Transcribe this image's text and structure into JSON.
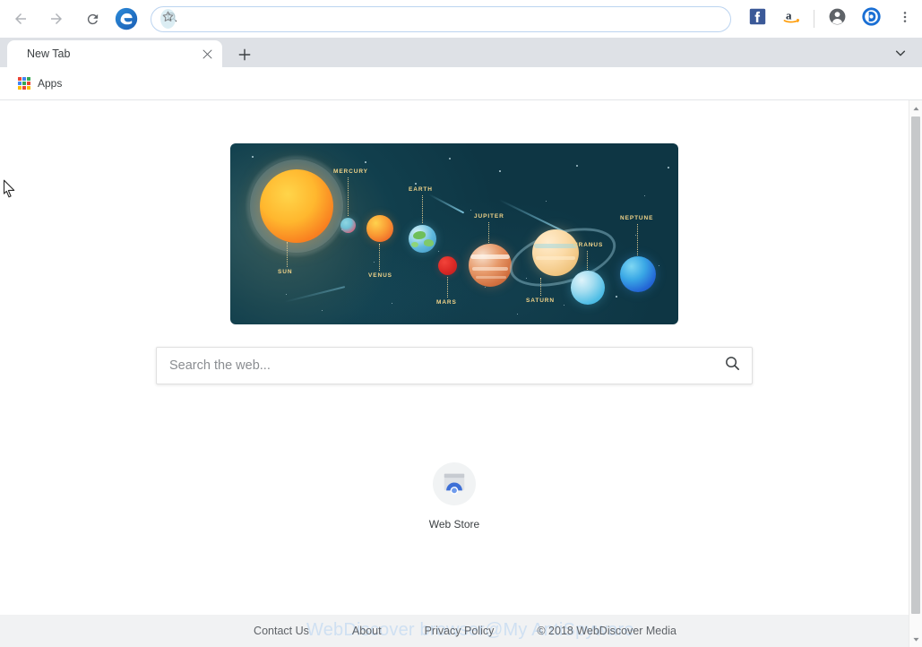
{
  "browser": {
    "toolbar": {
      "back_icon": "arrow-left-icon",
      "forward_icon": "arrow-right-icon",
      "reload_icon": "reload-icon",
      "brand_icon": "edge-logo-icon",
      "omnibox_value": "",
      "omnibox_placeholder": "",
      "omnibox_search_icon": "search-icon",
      "bookmark_star_icon": "star-icon",
      "ext_facebook_icon": "facebook-icon",
      "ext_amazon_icon": "amazon-icon",
      "profile_icon": "profile-avatar-icon",
      "webdiscover_icon": "webdiscover-icon",
      "menu_icon": "three-dot-menu-icon"
    },
    "tabstrip": {
      "tabs": [
        {
          "title": "New Tab",
          "close_icon": "close-icon"
        }
      ],
      "new_tab_icon": "plus-icon",
      "tab_list_icon": "chevron-down-icon"
    },
    "bookmarks": {
      "items": [
        {
          "label": "Apps",
          "icon": "apps-grid-icon"
        }
      ]
    },
    "scrollbar": {
      "up_icon": "caret-up-icon",
      "down_icon": "caret-down-icon"
    }
  },
  "page": {
    "banner": {
      "alt": "solar-system-illustration",
      "background_color": "#0e3644",
      "label_color": "#f2d489",
      "bodies": [
        {
          "name": "SUN",
          "label": "SUN"
        },
        {
          "name": "MERCURY",
          "label": "MERCURY"
        },
        {
          "name": "VENUS",
          "label": "VENUS"
        },
        {
          "name": "EARTH",
          "label": "EARTH"
        },
        {
          "name": "MARS",
          "label": "MARS"
        },
        {
          "name": "JUPITER",
          "label": "JUPITER"
        },
        {
          "name": "SATURN",
          "label": "SATURN"
        },
        {
          "name": "URANUS",
          "label": "URANUS"
        },
        {
          "name": "NEPTUNE",
          "label": "NEPTUNE"
        }
      ]
    },
    "search": {
      "value": "",
      "placeholder": "Search the web...",
      "submit_icon": "search-icon"
    },
    "shortcuts": [
      {
        "label": "Web Store",
        "icon": "web-store-icon"
      }
    ],
    "footer": {
      "links": [
        {
          "label": "Contact Us"
        },
        {
          "label": "About"
        },
        {
          "label": "Privacy Policy"
        }
      ],
      "copyright": "© 2018 WebDiscover Media",
      "watermark": "WebDiscover browser@My AntiSpyware",
      "caret_icon": "caret-down-icon"
    }
  }
}
